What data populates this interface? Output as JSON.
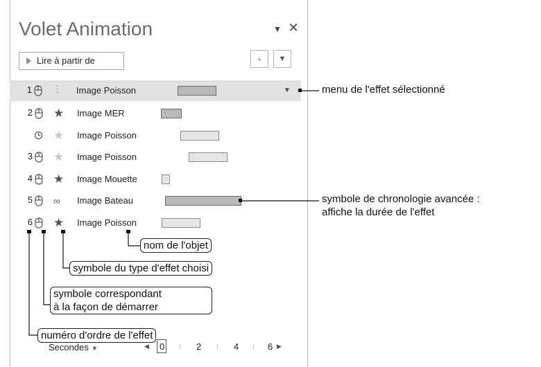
{
  "pane": {
    "title": "Volet Animation",
    "play_label": "Lire à partir de",
    "ctrl_dropdown_icon": "caret-down-icon",
    "ctrl_close_icon": "close-icon",
    "move_up_icon": "triangle-up-icon",
    "move_down_icon": "triangle-down-icon"
  },
  "effects": [
    {
      "order": "1",
      "start": "mouse-click-icon",
      "effect": "motion-path-icon",
      "name": "Image Poisson",
      "selected": true,
      "bar": "dark"
    },
    {
      "order": "2",
      "start": "mouse-click-icon",
      "effect": "star-icon",
      "name": "Image MER",
      "selected": false,
      "bar": "dark"
    },
    {
      "order": "",
      "start": "clock-icon",
      "effect": "star-icon",
      "name": "Image Poisson",
      "selected": false,
      "bar": "light"
    },
    {
      "order": "3",
      "start": "mouse-click-icon",
      "effect": "star-icon",
      "name": "Image Poisson",
      "selected": false,
      "bar": "light"
    },
    {
      "order": "4",
      "start": "mouse-click-icon",
      "effect": "star-icon",
      "name": "Image Mouette",
      "selected": false,
      "bar": "light"
    },
    {
      "order": "5",
      "start": "mouse-click-icon",
      "effect": "motion-path-icon",
      "name": "Image Bateau",
      "selected": false,
      "bar": "dark"
    },
    {
      "order": "6",
      "start": "mouse-click-icon",
      "effect": "star-icon",
      "name": "Image Poisson",
      "selected": false,
      "bar": "light"
    }
  ],
  "timeline": {
    "unit_label": "Secondes",
    "ticks": [
      "0",
      "2",
      "4",
      "6"
    ]
  },
  "callouts": {
    "selected_menu": "menu de l'effet sélectionné",
    "advanced_timeline_1": "symbole de chronologie avancée :",
    "advanced_timeline_2": "affiche la durée de l'effet",
    "object_name": "nom de l'objet",
    "effect_type": "symbole du type d'effet choisi",
    "start_mode_1": "symbole correspondant",
    "start_mode_2": "à la façon de démarrer",
    "order_number": "numéro d'ordre de l'effet"
  }
}
